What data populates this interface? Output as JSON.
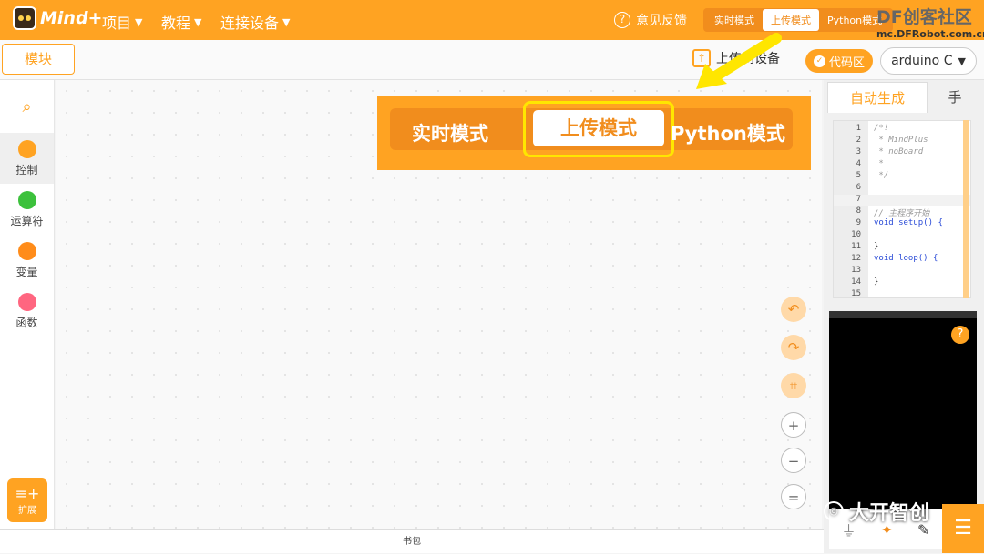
{
  "app": {
    "logo_text": "Mind+"
  },
  "menus": [
    {
      "label": "项目"
    },
    {
      "label": "教程"
    },
    {
      "label": "连接设备"
    }
  ],
  "feedback": {
    "label": "意见反馈"
  },
  "mode_switch": {
    "items": [
      "实时模式",
      "上传模式",
      "Python模式"
    ],
    "active": "上传模式"
  },
  "watermark": {
    "title": "DF创客社区",
    "url": "mc.DFRobot.com.cn"
  },
  "subbar": {
    "blocks_tab": "模块",
    "upload_label": "上传到设备",
    "code_button": "代码区",
    "board_select": "arduino C"
  },
  "sidebar": {
    "categories": [
      {
        "label": "控制",
        "color": "#ffa322"
      },
      {
        "label": "运算符",
        "color": "#3cc13c"
      },
      {
        "label": "变量",
        "color": "#ff8c1a"
      },
      {
        "label": "函数",
        "color": "#ff6680"
      }
    ],
    "extension_label": "扩展"
  },
  "zoom_callout": {
    "items": [
      "实时模式",
      "上传模式",
      "Python模式"
    ],
    "active": "上传模式"
  },
  "footer": {
    "label": "书包"
  },
  "right_panel": {
    "tabs": [
      "自动生成",
      "手"
    ],
    "code_lines": [
      {
        "n": "1",
        "text": "/*!",
        "cls": "cm"
      },
      {
        "n": "2",
        "text": " * MindPlus",
        "cls": "cm"
      },
      {
        "n": "3",
        "text": " * noBoard",
        "cls": "cm"
      },
      {
        "n": "4",
        "text": " *",
        "cls": "cm"
      },
      {
        "n": "5",
        "text": " */",
        "cls": "cm"
      },
      {
        "n": "6",
        "text": "",
        "cls": ""
      },
      {
        "n": "7",
        "text": "",
        "cls": "hl"
      },
      {
        "n": "8",
        "text": "// 主程序开始",
        "cls": "cm"
      },
      {
        "n": "9",
        "text": "void setup() {",
        "cls": "kw"
      },
      {
        "n": "10",
        "text": "",
        "cls": ""
      },
      {
        "n": "11",
        "text": "}",
        "cls": ""
      },
      {
        "n": "12",
        "text": "void loop() {",
        "cls": "kw"
      },
      {
        "n": "13",
        "text": "",
        "cls": ""
      },
      {
        "n": "14",
        "text": "}",
        "cls": ""
      },
      {
        "n": "15",
        "text": "",
        "cls": ""
      }
    ]
  },
  "overlay_watermark": {
    "text": "大开智创"
  }
}
